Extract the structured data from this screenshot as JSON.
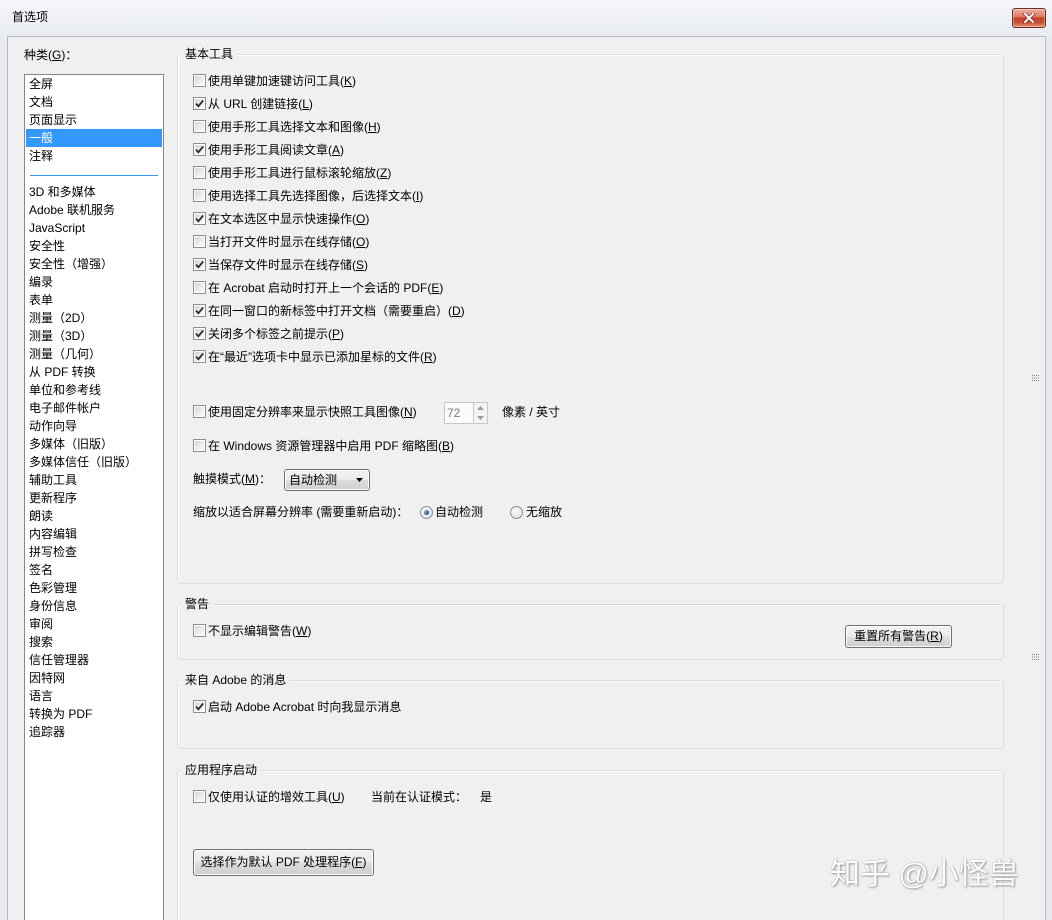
{
  "window": {
    "title": "首选项"
  },
  "icons": {
    "close": "close-icon",
    "checkmark": "checkmark-icon",
    "dropdown_arrow": "chevron-down-icon",
    "spin_up": "spin-up-icon",
    "spin_down": "spin-down-icon",
    "grip": "grip-icon"
  },
  "colors": {
    "selection": "#3399ff",
    "separator": "#3399ff",
    "close_button": "#c4432a"
  },
  "categories": {
    "label": "种类(G)：",
    "top_items": [
      "全屏",
      "文档",
      "页面显示",
      "一般",
      "注释"
    ],
    "items": [
      "3D 和多媒体",
      "Adobe 联机服务",
      "JavaScript",
      "安全性",
      "安全性（增强）",
      "编录",
      "表单",
      "测量（2D）",
      "测量（3D）",
      "测量（几何）",
      "从 PDF 转换",
      "单位和参考线",
      "电子邮件帐户",
      "动作向导",
      "多媒体（旧版）",
      "多媒体信任（旧版）",
      "辅助工具",
      "更新程序",
      "朗读",
      "内容编辑",
      "拼写检查",
      "签名",
      "色彩管理",
      "身份信息",
      "审阅",
      "搜索",
      "信任管理器",
      "因特网",
      "语言",
      "转换为 PDF",
      "追踪器"
    ],
    "selected_index": 3
  },
  "basic_tools": {
    "title": "基本工具",
    "options": [
      {
        "label": "使用单键加速键访问工具(K)",
        "checked": false
      },
      {
        "label": "从 URL 创建链接(L)",
        "checked": true
      },
      {
        "label": "使用手形工具选择文本和图像(H)",
        "checked": false
      },
      {
        "label": "使用手形工具阅读文章(A)",
        "checked": true
      },
      {
        "label": "使用手形工具进行鼠标滚轮缩放(Z)",
        "checked": false
      },
      {
        "label": "使用选择工具先选择图像，后选择文本(I)",
        "checked": false
      },
      {
        "label": "在文本选区中显示快速操作(O)",
        "checked": true
      },
      {
        "label": "当打开文件时显示在线存储(O)",
        "checked": false
      },
      {
        "label": "当保存文件时显示在线存储(S)",
        "checked": true
      },
      {
        "label": "在 Acrobat 启动时打开上一个会话的 PDF(E)",
        "checked": false
      },
      {
        "label": "在同一窗口的新标签中打开文档（需要重启）(D)",
        "checked": true
      },
      {
        "label": "关闭多个标签之前提示(P)",
        "checked": true
      },
      {
        "label": "在“最近”选项卡中显示已添加星标的文件(R)",
        "checked": true
      }
    ],
    "snapshot": {
      "label": "使用固定分辨率来显示快照工具图像(N)",
      "checked": false,
      "value": "72",
      "unit": "像素 / 英寸"
    },
    "thumbnails": {
      "label": "在 Windows 资源管理器中启用 PDF 缩略图(B)",
      "checked": false
    },
    "touch_mode": {
      "label": "触摸模式(M)：",
      "value": "自动检测"
    },
    "scaling": {
      "label": "缩放以适合屏幕分辨率 (需要重新启动)：",
      "options": [
        {
          "label": "自动检测",
          "selected": true
        },
        {
          "label": "无缩放",
          "selected": false
        }
      ]
    }
  },
  "warnings": {
    "title": "警告",
    "hide_edit_warnings": {
      "label": "不显示编辑警告(W)",
      "checked": false
    },
    "reset_button": "重置所有警告(R)"
  },
  "adobe_messages": {
    "title": "来自 Adobe 的消息",
    "show_on_launch": {
      "label": "启动 Adobe Acrobat 时向我显示消息",
      "checked": true
    }
  },
  "app_startup": {
    "title": "应用程序启动",
    "certified_plugins_only": {
      "label": "仅使用认证的增效工具(U)",
      "checked": false
    },
    "certified_mode_label": "当前在认证模式：",
    "certified_mode_value": "是",
    "default_handler_button": "选择作为默认 PDF 处理程序(F)"
  },
  "watermark": "知乎 @小怪兽"
}
